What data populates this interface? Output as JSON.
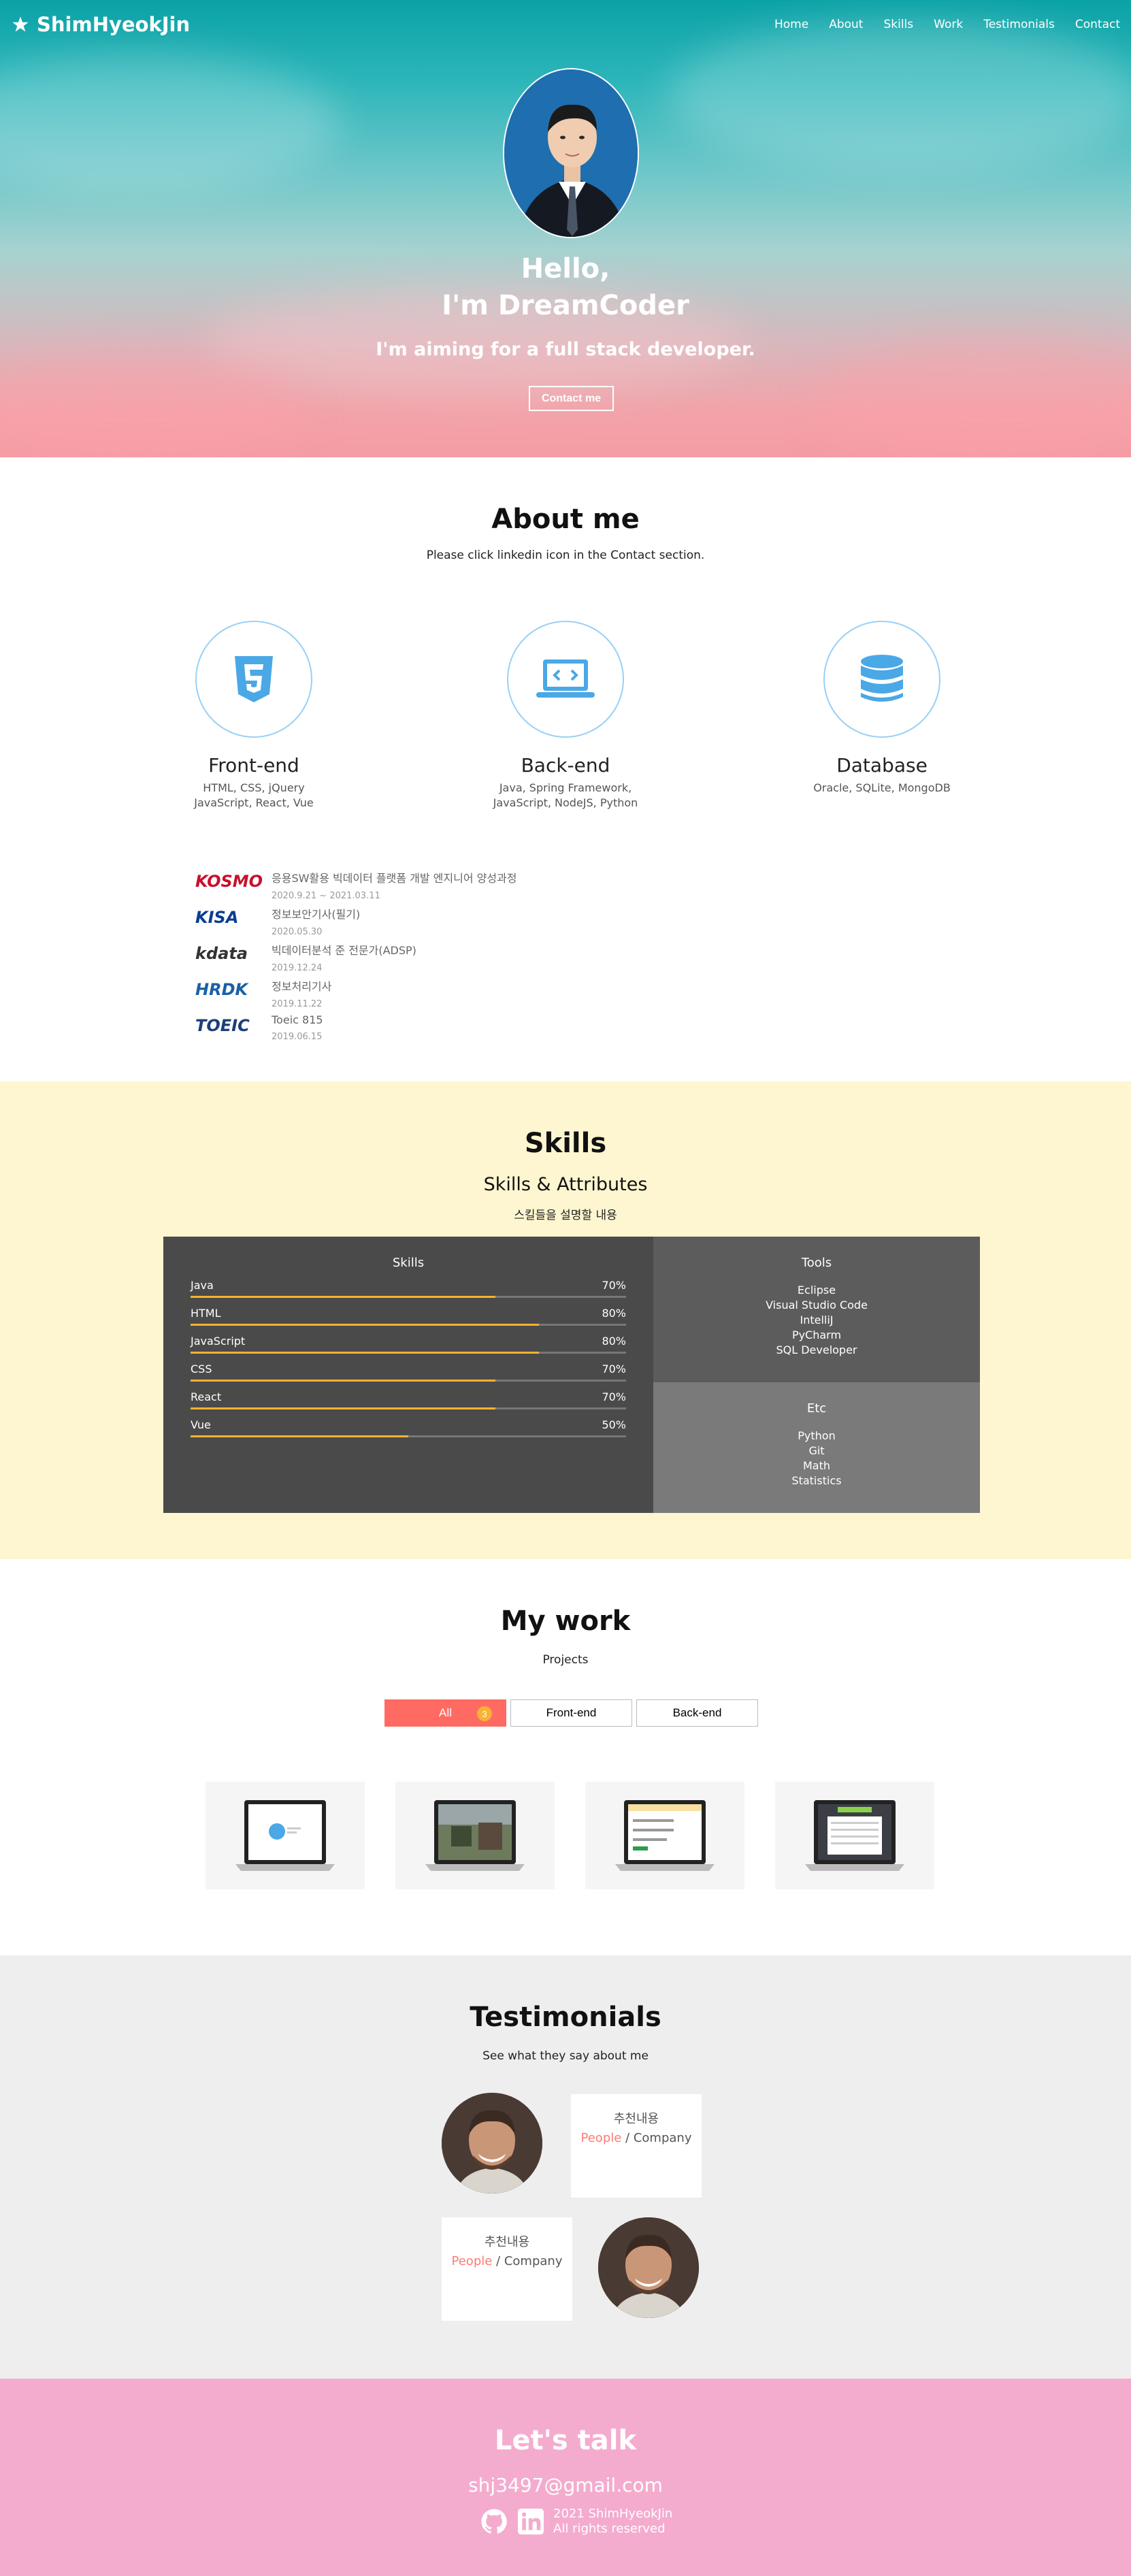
{
  "nav": {
    "logo": "ShimHyeokJin",
    "menu": [
      "Home",
      "About",
      "Skills",
      "Work",
      "Testimonials",
      "Contact"
    ]
  },
  "home": {
    "title1": "Hello,",
    "title2": "I'm DreamCoder",
    "description": "I'm aiming for a full stack developer.",
    "contact_button": "Contact me"
  },
  "about": {
    "title": "About me",
    "description": "Please click linkedin icon in the Contact section.",
    "majors": [
      {
        "icon": "html5-icon",
        "name": "Front-end",
        "desc1": "HTML, CSS, jQuery",
        "desc2": "JavaScript, React, Vue"
      },
      {
        "icon": "laptop-code-icon",
        "name": "Back-end",
        "desc1": "Java, Spring Framework,",
        "desc2": "JavaScript, NodeJS, Python"
      },
      {
        "icon": "database-icon",
        "name": "Database",
        "desc1": "Oracle, SQLite, MongoDB",
        "desc2": ""
      }
    ],
    "jobs": [
      {
        "logo": "KOSMO",
        "logo_color": "#c8102e",
        "desc": "응용SW활용 빅데이터 플랫폼 개발 엔지니어 양성과정",
        "date": "2020.9.21 ~ 2021.03.11"
      },
      {
        "logo": "KISA",
        "logo_color": "#0b3d91",
        "desc": "정보보안기사(필기)",
        "date": "2020.05.30"
      },
      {
        "logo": "kdata",
        "logo_color": "#333333",
        "desc": "빅데이터분석 준 전문가(ADSP)",
        "date": "2019.12.24"
      },
      {
        "logo": "HRDK",
        "logo_color": "#1b5fa8",
        "desc": "정보처리기사",
        "date": "2019.11.22"
      },
      {
        "logo": "TOEIC",
        "logo_color": "#1c3f7a",
        "desc": "Toeic 815",
        "date": "2019.06.15"
      }
    ]
  },
  "skills": {
    "title": "Skills",
    "subtitle": "Skills & Attributes",
    "description": "스킬들을 설명할 내용",
    "skills_title": "Skills",
    "items": [
      {
        "name": "Java",
        "percent": "70%",
        "level": 70
      },
      {
        "name": "HTML",
        "percent": "80%",
        "level": 80
      },
      {
        "name": "JavaScript",
        "percent": "80%",
        "level": 80
      },
      {
        "name": "CSS",
        "percent": "70%",
        "level": 70
      },
      {
        "name": "React",
        "percent": "70%",
        "level": 70
      },
      {
        "name": "Vue",
        "percent": "50%",
        "level": 50
      }
    ],
    "tools_title": "Tools",
    "tools": [
      "Eclipse",
      "Visual Studio Code",
      "IntelliJ",
      "PyCharm",
      "SQL Developer"
    ],
    "etc_title": "Etc",
    "etc": [
      "Python",
      "Git",
      "Math",
      "Statistics"
    ]
  },
  "work": {
    "title": "My work",
    "description": "Projects",
    "categories": [
      {
        "label": "All",
        "count": "3"
      },
      {
        "label": "Front-end"
      },
      {
        "label": "Back-end"
      }
    ]
  },
  "testimonials": {
    "title": "Testimonials",
    "description": "See what they say about me",
    "items": [
      {
        "text": "추천내용",
        "name": "People",
        "company": " / Company"
      },
      {
        "text": "추천내용",
        "name": "People",
        "company": " / Company"
      }
    ]
  },
  "contact": {
    "title": "Let's talk",
    "email": "shj3497@gmail.com",
    "rights1": "2021 ShimHyeokJin",
    "rights2": "All rights reserved"
  }
}
